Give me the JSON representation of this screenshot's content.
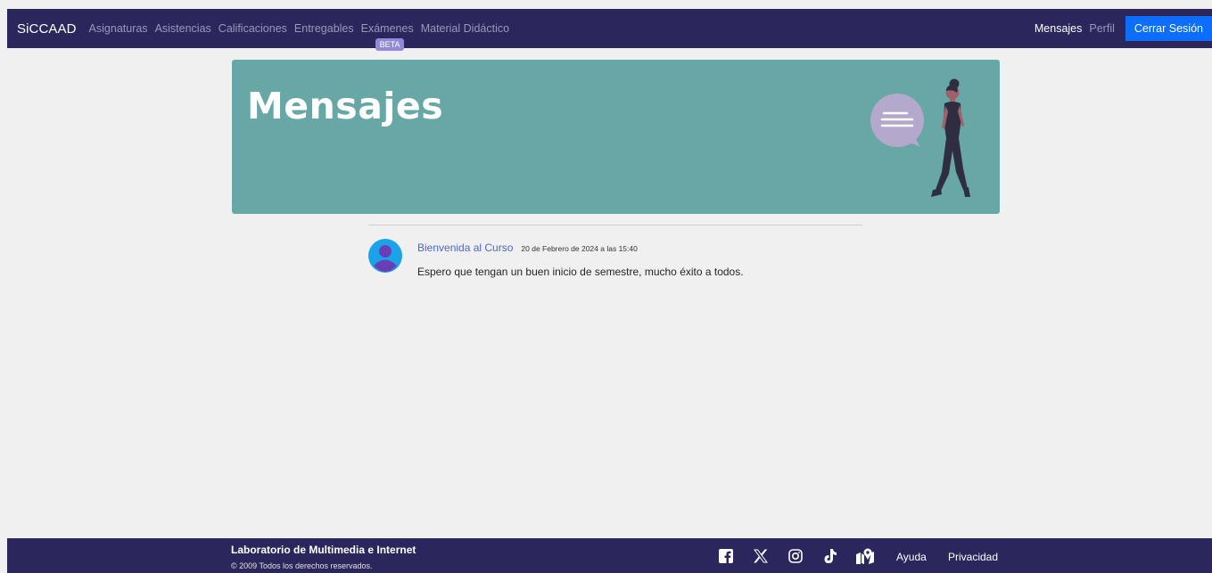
{
  "navbar": {
    "brand": "SiCCAAD",
    "links": [
      {
        "label": "Asignaturas"
      },
      {
        "label": "Asistencias"
      },
      {
        "label": "Calificaciones"
      },
      {
        "label": "Entregables"
      },
      {
        "label": "Exámenes",
        "badge": "BETA"
      },
      {
        "label": "Material Didáctico"
      }
    ],
    "messages_label": "Mensajes",
    "profile_label": "Perfil",
    "logout_label": "Cerrar Sesión"
  },
  "hero": {
    "title": "Mensajes",
    "background_color": "#67a8a6"
  },
  "messages": [
    {
      "title": "Bienvenida al Curso",
      "date": "20 de Febrero de 2024 a las 15:40",
      "body": "Espero que tengan un buen inicio de semestre, mucho éxito a todos."
    }
  ],
  "footer": {
    "organization": "Laboratorio de Multimedia e Internet",
    "copyright": "© 2009 Todos los derechos reservados.",
    "social_icons": [
      "facebook-icon",
      "x-icon",
      "instagram-icon",
      "tiktok-icon",
      "map-location-icon"
    ],
    "help_label": "Ayuda",
    "privacy_label": "Privacidad"
  },
  "colors": {
    "navbar": "#2b275c",
    "accent": "#0d6efd",
    "link": "#4a68c9",
    "badge": "#8f89d8"
  }
}
